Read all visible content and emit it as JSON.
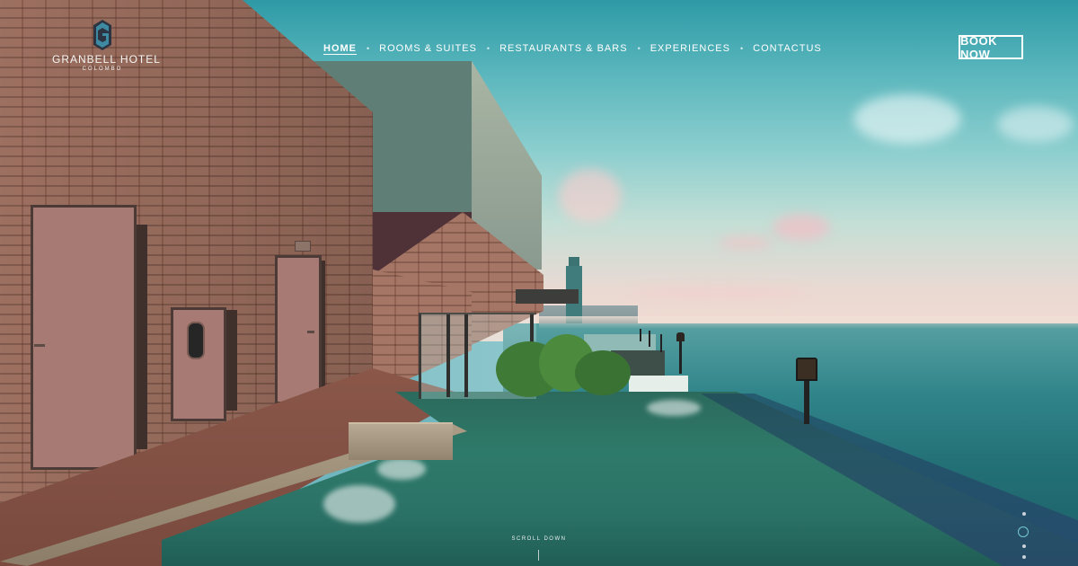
{
  "brand": {
    "name": "GRANBELL HOTEL",
    "city": "COLOMBO"
  },
  "nav": {
    "items": [
      {
        "label": "HOME",
        "active": true
      },
      {
        "label": "ROOMS & SUITES",
        "active": false
      },
      {
        "label": "RESTAURANTS & BARS",
        "active": false
      },
      {
        "label": "EXPERIENCES",
        "active": false
      },
      {
        "label": "CONTACTUS",
        "active": false
      }
    ],
    "separator": "•"
  },
  "cta": {
    "book_label": "BOOK NOW"
  },
  "hero": {
    "scroll_label": "SCROLL DOWN",
    "slide_count": 4,
    "active_slide": 1
  },
  "colors": {
    "text": "#ffffff",
    "accent": "#74c9d3",
    "logo_mark": "#2f6f86"
  }
}
